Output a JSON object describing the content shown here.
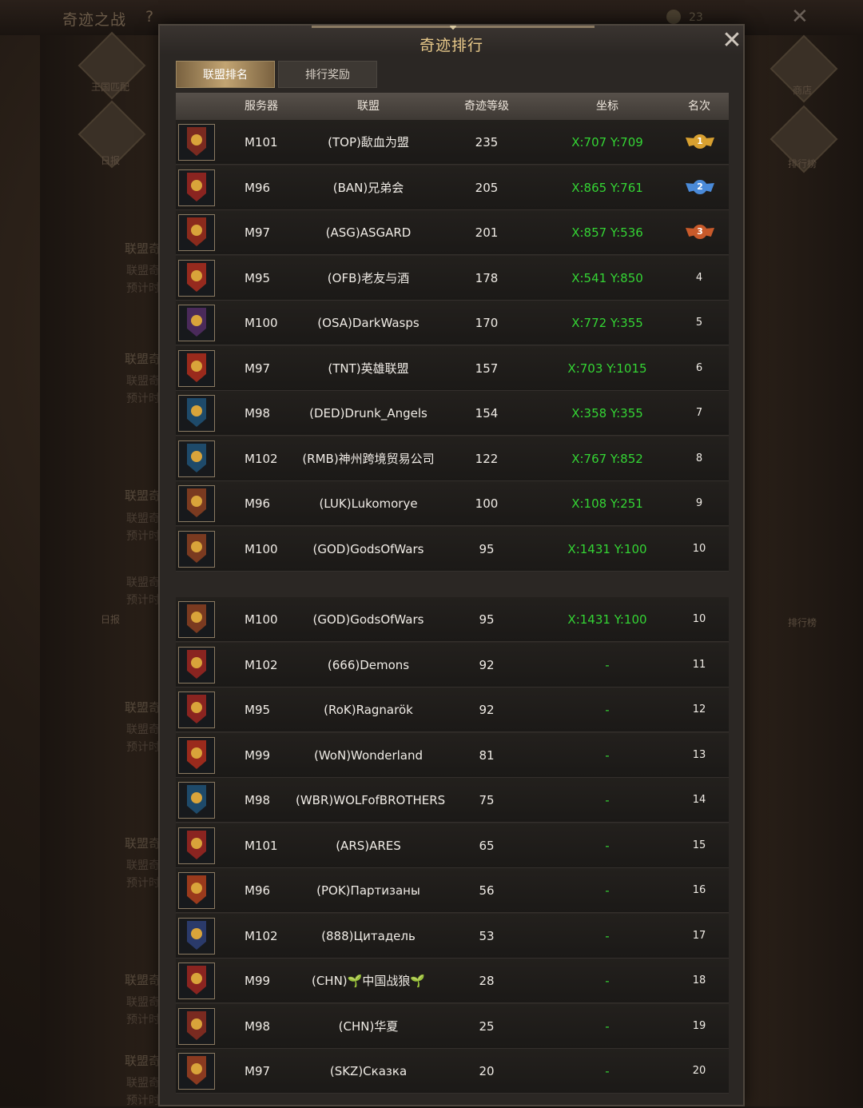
{
  "background": {
    "title": "奇迹之战",
    "help": "?",
    "coin_value": "23",
    "left_menu": [
      "王国匹配",
      "日报"
    ],
    "right_menu": [
      "商店",
      "排行榜"
    ],
    "ghost_text": {
      "alliance": "联盟奇",
      "estimate": "预计时",
      "daily": "日报",
      "ranking": "排行榜"
    }
  },
  "modal": {
    "title": "奇迹排行",
    "tabs": [
      {
        "label": "联盟排名",
        "active": true
      },
      {
        "label": "排行奖励",
        "active": false
      }
    ],
    "columns": [
      "服务器",
      "联盟",
      "奇迹等级",
      "坐标",
      "名次"
    ],
    "rows_top": [
      {
        "server": "M101",
        "alliance": "(TOP)歃血为盟",
        "level": "235",
        "coord": "X:707 Y:709",
        "rank": "1",
        "emblem": "#7a2a20",
        "medal": "gold"
      },
      {
        "server": "M96",
        "alliance": "(BAN)兄弟会",
        "level": "205",
        "coord": "X:865 Y:761",
        "rank": "2",
        "emblem": "#8a2420",
        "medal": "silver"
      },
      {
        "server": "M97",
        "alliance": "(ASG)ASGARD",
        "level": "201",
        "coord": "X:857 Y:536",
        "rank": "3",
        "emblem": "#8a2a1c",
        "medal": "bronze"
      },
      {
        "server": "M95",
        "alliance": "(OFB)老友与酒",
        "level": "178",
        "coord": "X:541 Y:850",
        "rank": "4",
        "emblem": "#962a1e"
      },
      {
        "server": "M100",
        "alliance": "(OSA)DarkWasps",
        "level": "170",
        "coord": "X:772 Y:355",
        "rank": "5",
        "emblem": "#4a2a5a"
      },
      {
        "server": "M97",
        "alliance": "(TNT)英雄联盟",
        "level": "157",
        "coord": "X:703 Y:1015",
        "rank": "6",
        "emblem": "#9a2a1c"
      },
      {
        "server": "M98",
        "alliance": "(DED)Drunk_Angels",
        "level": "154",
        "coord": "X:358 Y:355",
        "rank": "7",
        "emblem": "#1e4a6a"
      },
      {
        "server": "M102",
        "alliance": "(RMB)神州跨境贸易公司",
        "level": "122",
        "coord": "X:767 Y:852",
        "rank": "8",
        "emblem": "#1e4a6a"
      },
      {
        "server": "M96",
        "alliance": "(LUK)Lukomorye",
        "level": "100",
        "coord": "X:108 Y:251",
        "rank": "9",
        "emblem": "#7a3a20"
      },
      {
        "server": "M100",
        "alliance": "(GOD)GodsOfWars",
        "level": "95",
        "coord": "X:1431 Y:100",
        "rank": "10",
        "emblem": "#7a3a20"
      }
    ],
    "rows_bottom": [
      {
        "server": "M100",
        "alliance": "(GOD)GodsOfWars",
        "level": "95",
        "coord": "X:1431 Y:100",
        "rank": "10",
        "emblem": "#7a3a20"
      },
      {
        "server": "M102",
        "alliance": "(666)Demons",
        "level": "92",
        "coord": "-",
        "rank": "11",
        "emblem": "#8a2420"
      },
      {
        "server": "M95",
        "alliance": "(RoK)Ragnarök",
        "level": "92",
        "coord": "-",
        "rank": "12",
        "emblem": "#8a2420"
      },
      {
        "server": "M99",
        "alliance": "(WoN)Wonderland",
        "level": "81",
        "coord": "-",
        "rank": "13",
        "emblem": "#9a2a1c"
      },
      {
        "server": "M98",
        "alliance": "(WBR)WOLFofBROTHERS",
        "level": "75",
        "coord": "-",
        "rank": "14",
        "emblem": "#1e4a6a"
      },
      {
        "server": "M101",
        "alliance": "(ARS)ARES",
        "level": "65",
        "coord": "-",
        "rank": "15",
        "emblem": "#8a2420"
      },
      {
        "server": "M96",
        "alliance": "(POK)Партизаны",
        "level": "56",
        "coord": "-",
        "rank": "16",
        "emblem": "#9a3a1c"
      },
      {
        "server": "M102",
        "alliance": "(888)Цитадель",
        "level": "53",
        "coord": "-",
        "rank": "17",
        "emblem": "#2a3a6a"
      },
      {
        "server": "M99",
        "alliance": "(CHN)🌱中国战狼🌱",
        "level": "28",
        "coord": "-",
        "rank": "18",
        "emblem": "#8a2420"
      },
      {
        "server": "M98",
        "alliance": "(CHN)华夏",
        "level": "25",
        "coord": "-",
        "rank": "19",
        "emblem": "#7a2a20"
      },
      {
        "server": "M97",
        "alliance": "(SKZ)Сказка",
        "level": "20",
        "coord": "-",
        "rank": "20",
        "emblem": "#8a3a20"
      }
    ]
  },
  "colors": {
    "coord_green": "#34d434",
    "title_gold": "#e8c98a",
    "gold_medal": "#d8a030",
    "silver_medal": "#4a8ad8",
    "bronze_medal": "#c85a2a"
  },
  "icons": {
    "close": "close-icon",
    "alliance_emblem": "alliance-emblem-icon",
    "rank_medal": "rank-medal-icon"
  }
}
